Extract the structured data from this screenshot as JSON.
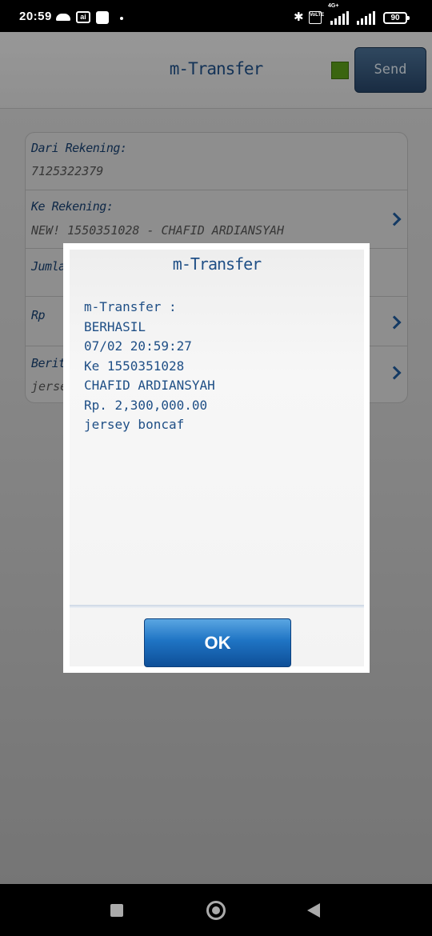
{
  "status_bar": {
    "time": "20:59",
    "battery": "90",
    "network": "4G+",
    "icons": [
      "cloud-icon",
      "ai-badge-icon",
      "notification-square-icon",
      "dot-icon",
      "bluetooth-icon",
      "volte-icon",
      "signal-icon",
      "signal-icon",
      "battery-icon"
    ],
    "ai_label": "ai",
    "volte_label": "VoLTE"
  },
  "header": {
    "title": "m-Transfer",
    "send_label": "Send",
    "status_color": "#5a9b1a"
  },
  "form": {
    "from_label": "Dari Rekening:",
    "from_value": "7125322379",
    "to_label": "Ke Rekening:",
    "to_value": "NEW! 1550351028 - CHAFID ARDIANSYAH",
    "amount_label": "Jumlah",
    "currency_label": "Rp",
    "news_label": "Berita",
    "news_value": "jersey boncaf"
  },
  "dialog": {
    "title": "m-Transfer",
    "lines": [
      "m-Transfer :",
      "BERHASIL",
      "07/02 20:59:27",
      "Ke 1550351028",
      "CHAFID ARDIANSYAH",
      "Rp. 2,300,000.00",
      "jersey boncaf"
    ],
    "ok_label": "OK"
  },
  "colors": {
    "accent": "#1f4f86",
    "button_blue": "#1f74c4"
  }
}
